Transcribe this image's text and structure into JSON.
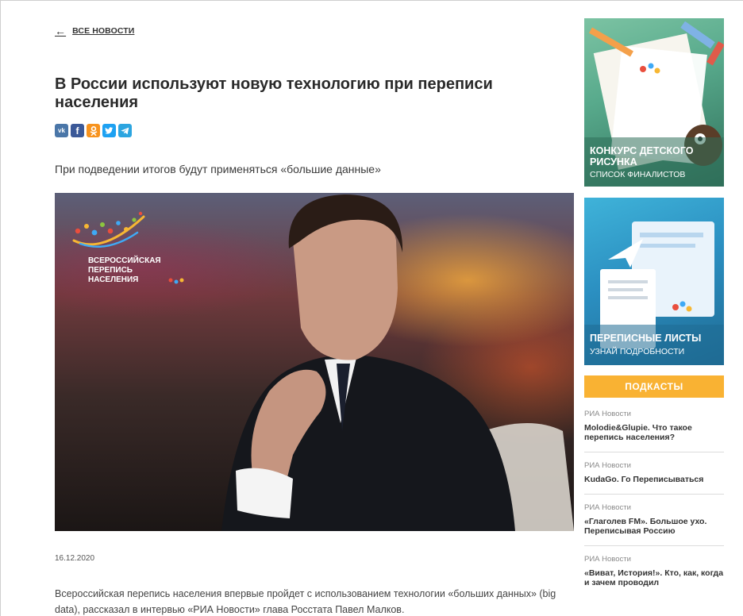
{
  "article": {
    "back_label": "ВСЕ НОВОСТИ",
    "title": "В России используют новую технологию при переписи населения",
    "share": [
      "vk",
      "f",
      "ok",
      "tw",
      "tg"
    ],
    "lead": "При подведении итогов будут применяться «большие данные»",
    "hero": {
      "logo_text_1": "ВСЕРОССИЙСКАЯ",
      "logo_text_2": "ПЕРЕПИСЬ",
      "logo_text_3": "НАСЕЛЕНИЯ"
    },
    "date": "16.12.2020",
    "body": "Всероссийская перепись населения впервые пройдет с использованием технологии «больших данных» (big data), рассказал в интервью «РИА Новости» глава Росстата Павел Малков."
  },
  "sidebar": {
    "banner1": {
      "title": "КОНКУРС ДЕТСКОГО РИСУНКА",
      "subtitle": "СПИСОК ФИНАЛИСТОВ"
    },
    "banner2": {
      "title": "ПЕРЕПИСНЫЕ ЛИСТЫ",
      "subtitle": "УЗНАЙ ПОДРОБНОСТИ"
    },
    "podcasts_label": "ПОДКАСТЫ",
    "podcasts": [
      {
        "source": "РИА Новости",
        "title": "Molodie&Glupie. Что такое перепись населения?"
      },
      {
        "source": "РИА Новости",
        "title": "KudaGo. Го Переписываться"
      },
      {
        "source": "РИА Новости",
        "title": "«Глаголев FM». Большое ухо. Переписывая Россию"
      },
      {
        "source": "РИА Новости",
        "title": "«Виват, История!». Кто, как, когда и зачем проводил"
      }
    ]
  },
  "colors": {
    "accent_orange": "#f9b233",
    "vk": "#4a76a8",
    "facebook": "#3b5998",
    "odnoklassniki": "#f7931e",
    "twitter": "#1da1f2",
    "telegram": "#2ca5e0"
  }
}
